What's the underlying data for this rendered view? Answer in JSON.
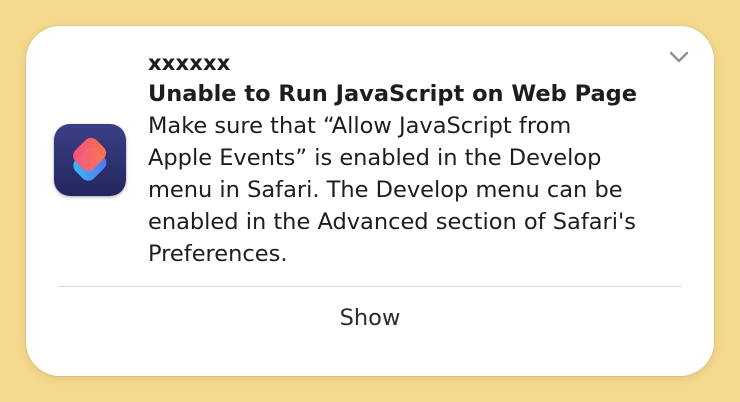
{
  "notification": {
    "app_name": "xxxxxx",
    "title": "Unable to Run JavaScript on Web Page",
    "body_lines": [
      "Make sure that “Allow JavaScript from",
      "Apple Events” is enabled in the Develop",
      "menu in Safari. The Develop menu can be",
      "enabled in the Advanced section of Safari's",
      "Preferences."
    ],
    "action_label": "Show",
    "icon": "shortcuts-app-icon",
    "collapse_icon": "chevron-down-icon"
  },
  "colors": {
    "background": "#f5d98c",
    "card": "#ffffff",
    "text": "#1d1d1f",
    "divider": "#d6d6d8"
  }
}
